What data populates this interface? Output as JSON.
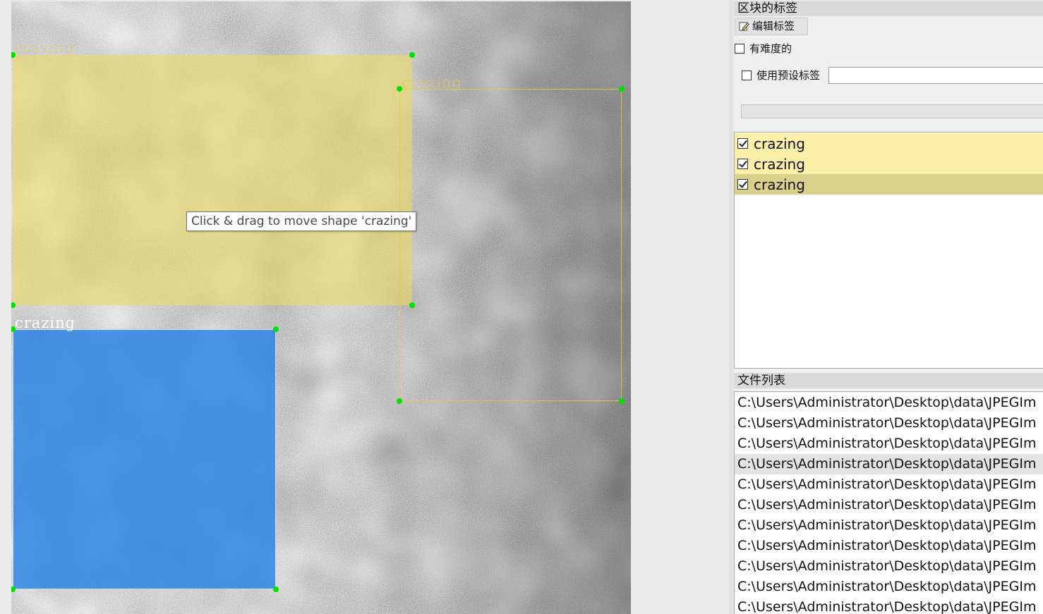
{
  "canvas": {
    "shapes": [
      {
        "label": "crazing",
        "fill_color": "#ecda5c",
        "style": "filled"
      },
      {
        "label": "crazing",
        "line_color": "#dccd46",
        "style": "outline"
      },
      {
        "label": "crazing",
        "fill_color": "#2882e6",
        "style": "filled"
      }
    ],
    "vertex_color": "#00e000",
    "tooltip": "Click & drag to move shape 'crazing'"
  },
  "dock": {
    "label_panel": {
      "title": "区块的标签",
      "edit_button": "编辑标签",
      "edit_icon": "pencil-icon",
      "difficult_label": "有难度的",
      "difficult_checked": false,
      "use_preset_label": "使用预设标签",
      "use_preset_checked": false,
      "preset_value": "",
      "labels": [
        {
          "text": "crazing",
          "checked": true,
          "color": "#fcf0a8"
        },
        {
          "text": "crazing",
          "checked": true,
          "color": "#fcf0a8"
        },
        {
          "text": "crazing",
          "checked": true,
          "color": "#d9d08c"
        }
      ]
    },
    "file_panel": {
      "title": "文件列表",
      "files": [
        "C:\\Users\\Administrator\\Desktop\\data\\JPEGIm",
        "C:\\Users\\Administrator\\Desktop\\data\\JPEGIm",
        "C:\\Users\\Administrator\\Desktop\\data\\JPEGIm",
        "C:\\Users\\Administrator\\Desktop\\data\\JPEGIm",
        "C:\\Users\\Administrator\\Desktop\\data\\JPEGIm",
        "C:\\Users\\Administrator\\Desktop\\data\\JPEGIm",
        "C:\\Users\\Administrator\\Desktop\\data\\JPEGIm",
        "C:\\Users\\Administrator\\Desktop\\data\\JPEGIm",
        "C:\\Users\\Administrator\\Desktop\\data\\JPEGIm",
        "C:\\Users\\Administrator\\Desktop\\data\\JPEGIm",
        "C:\\Users\\Administrator\\Desktop\\data\\JPEGIm"
      ],
      "selected_index": 3
    }
  }
}
